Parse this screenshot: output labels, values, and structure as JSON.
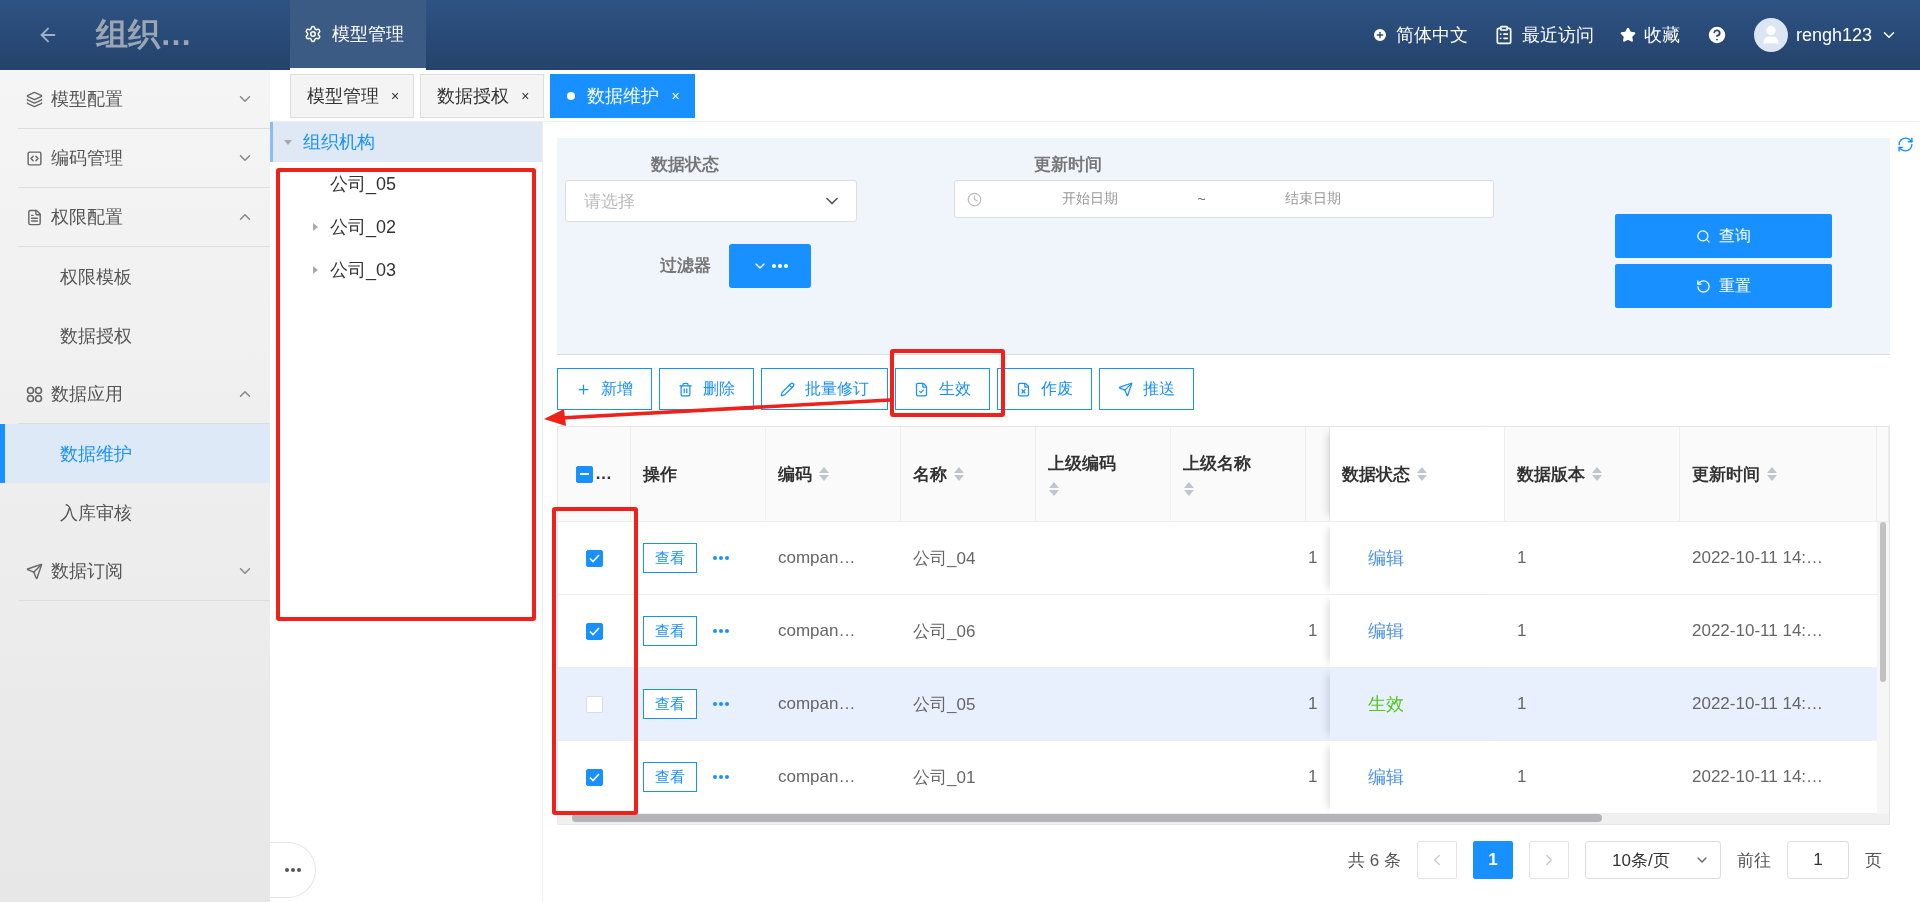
{
  "header": {
    "title": "组织…",
    "module_tab": {
      "label": "模型管理",
      "selected": true
    },
    "language": "简体中文",
    "recent": "最近访问",
    "favorites": "收藏",
    "user": "rengh123"
  },
  "sidebar": {
    "items": [
      {
        "label": "模型配置",
        "expanded": false
      },
      {
        "label": "编码管理",
        "expanded": false
      },
      {
        "label": "权限配置",
        "expanded": true,
        "children": [
          {
            "label": "权限模板",
            "selected": false
          },
          {
            "label": "数据授权",
            "selected": false
          }
        ]
      },
      {
        "label": "数据应用",
        "expanded": true,
        "children": [
          {
            "label": "数据维护",
            "selected": true
          },
          {
            "label": "入库审核",
            "selected": false
          }
        ]
      },
      {
        "label": "数据订阅",
        "expanded": false
      }
    ]
  },
  "tabs": [
    {
      "label": "模型管理",
      "close": "×",
      "selected": false
    },
    {
      "label": "数据授权",
      "close": "×",
      "selected": false
    },
    {
      "label": "数据维护",
      "close": "×",
      "selected": true
    }
  ],
  "tree": {
    "label": "组织机构",
    "expanded": true,
    "selected": true,
    "children": [
      {
        "label": "公司_05",
        "expandable": false
      },
      {
        "label": "公司_02",
        "expandable": true
      },
      {
        "label": "公司_03",
        "expandable": true
      }
    ]
  },
  "filter": {
    "status": {
      "label": "数据状态",
      "placeholder": "请选择"
    },
    "update_time": {
      "label": "更新时间",
      "start_placeholder": "开始日期",
      "separator": "~",
      "end_placeholder": "结束日期"
    },
    "filter_label": "过滤器",
    "query_button": "查询",
    "reset_button": "重置"
  },
  "toolbar": [
    "新增",
    "删除",
    "批量修订",
    "生效",
    "作废",
    "推送"
  ],
  "table": {
    "select_all": {
      "indeterminate": true,
      "label": "…"
    },
    "columns": [
      {
        "label": "操作",
        "sortable": false
      },
      {
        "label": "编码",
        "sortable": true
      },
      {
        "label": "名称",
        "sortable": true
      },
      {
        "label": "上级编码",
        "sortable": true
      },
      {
        "label": "上级名称",
        "sortable": true
      },
      {
        "sortable": false
      },
      {
        "label": "数据状态",
        "sortable": true
      },
      {
        "label": "数据版本",
        "sortable": true
      },
      {
        "label": "更新时间",
        "sortable": true
      }
    ],
    "rows": [
      {
        "checked": true,
        "highlighted": false,
        "action": "查看",
        "code": "compan…",
        "name": "公司_04",
        "column_7": "1",
        "status": {
          "text": "编辑",
          "color": "#4a90e2"
        },
        "version": "1",
        "updated": "2022-10-11 14:…"
      },
      {
        "checked": true,
        "highlighted": false,
        "action": "查看",
        "code": "compan…",
        "name": "公司_06",
        "column_7": "1",
        "status": {
          "text": "编辑",
          "color": "#4a90e2"
        },
        "version": "1",
        "updated": "2022-10-11 14:…"
      },
      {
        "checked": false,
        "highlighted": true,
        "action": "查看",
        "code": "compan…",
        "name": "公司_05",
        "column_7": "1",
        "status": {
          "text": "生效",
          "color": "#52c41a"
        },
        "version": "1",
        "updated": "2022-10-11 14:…"
      },
      {
        "checked": true,
        "highlighted": false,
        "action": "查看",
        "code": "compan…",
        "name": "公司_01",
        "column_7": "1",
        "status": {
          "text": "编辑",
          "color": "#4a90e2"
        },
        "version": "1",
        "updated": "2022-10-11 14:…"
      }
    ]
  },
  "pagination": {
    "total": "共 6 条",
    "pages": [
      {
        "label": "1",
        "selected": true
      }
    ],
    "page_size": "10条/页",
    "goto_label": "前往",
    "goto_value": "1",
    "page_suffix": "页"
  },
  "annotations": [
    {
      "kind": "box"
    },
    {
      "kind": "box"
    },
    {
      "kind": "box"
    },
    {
      "kind": "arrow"
    }
  ]
}
